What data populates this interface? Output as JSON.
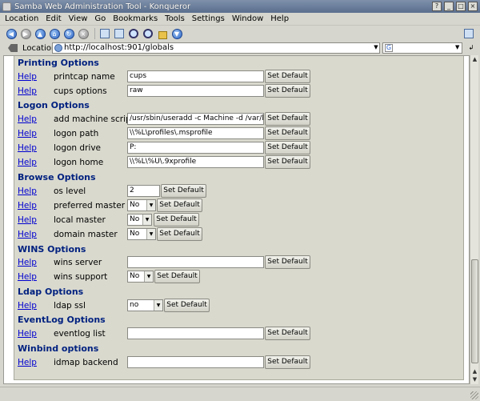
{
  "window": {
    "title": "Samba Web Administration Tool - Konqueror"
  },
  "menu": [
    "Location",
    "Edit",
    "View",
    "Go",
    "Bookmarks",
    "Tools",
    "Settings",
    "Window",
    "Help"
  ],
  "location": {
    "label": "Location:",
    "url": "http://localhost:901/globals"
  },
  "help_label": "Help",
  "set_default_label": "Set Default",
  "sections": {
    "printing": "Printing Options",
    "logon": "Logon Options",
    "browse": "Browse Options",
    "wins": "WINS Options",
    "ldap": "Ldap Options",
    "eventlog": "EventLog Options",
    "winbind": "Winbind options"
  },
  "rows": {
    "printcap_name": {
      "label": "printcap name",
      "value": "cups"
    },
    "cups_options": {
      "label": "cups options",
      "value": "raw"
    },
    "add_machine_script": {
      "label": "add machine script",
      "value": "/usr/sbin/useradd  -c Machine -d /var/lib/nobody"
    },
    "logon_path": {
      "label": "logon path",
      "value": "\\\\%L\\profiles\\.msprofile"
    },
    "logon_drive": {
      "label": "logon drive",
      "value": "P:"
    },
    "logon_home": {
      "label": "logon home",
      "value": "\\\\%L\\%U\\.9xprofile"
    },
    "os_level": {
      "label": "os level",
      "value": "2"
    },
    "preferred_master": {
      "label": "preferred master",
      "value": "No"
    },
    "local_master": {
      "label": "local master",
      "value": "No"
    },
    "domain_master": {
      "label": "domain master",
      "value": "No"
    },
    "wins_server": {
      "label": "wins server",
      "value": ""
    },
    "wins_support": {
      "label": "wins support",
      "value": "No"
    },
    "ldap_ssl": {
      "label": "ldap ssl",
      "value": "no"
    },
    "eventlog_list": {
      "label": "eventlog list",
      "value": ""
    },
    "idmap_backend": {
      "label": "idmap backend",
      "value": ""
    }
  }
}
